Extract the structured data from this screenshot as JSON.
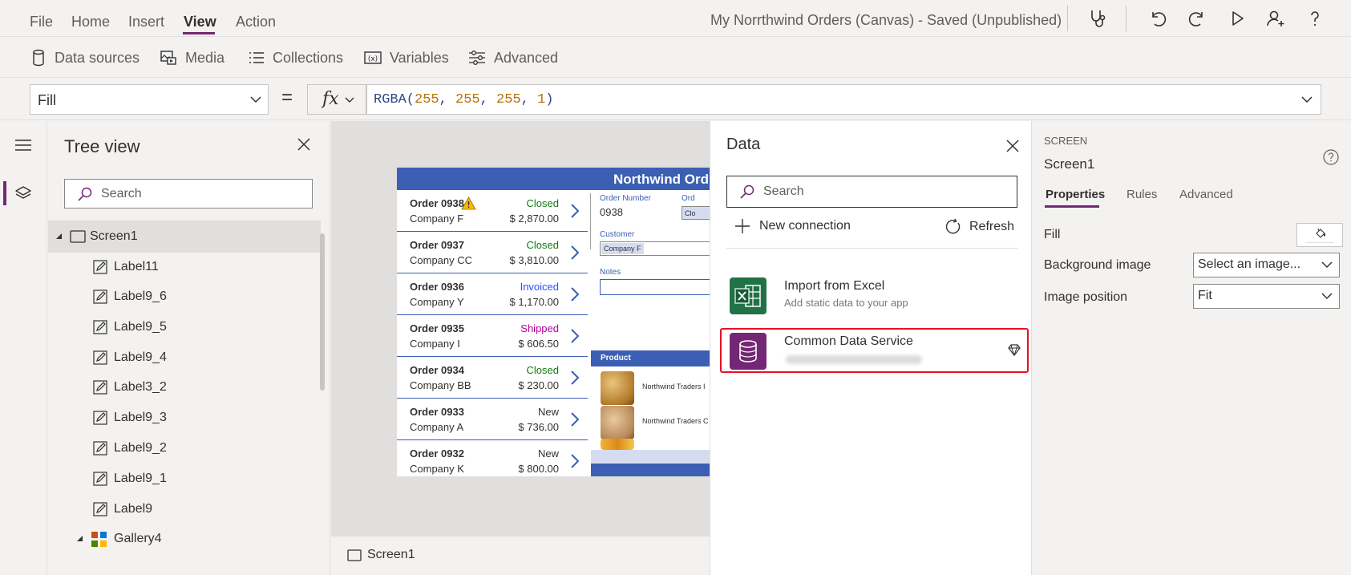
{
  "menu": {
    "items": [
      "File",
      "Home",
      "Insert",
      "View",
      "Action"
    ],
    "active": "View",
    "app_title": "My Norrthwind Orders (Canvas) - Saved (Unpublished)"
  },
  "toolbar_icons": [
    "stethoscope-icon",
    "undo-icon",
    "redo-icon",
    "play-icon",
    "add-user-icon",
    "help-icon"
  ],
  "ribbon": {
    "data_sources": "Data sources",
    "media": "Media",
    "collections": "Collections",
    "variables": "Variables",
    "advanced": "Advanced"
  },
  "formula": {
    "property": "Fill",
    "equals": "=",
    "fx": "fx",
    "fn": "RGBA(",
    "args": [
      "255",
      "255",
      "255",
      "1"
    ],
    "close": ")"
  },
  "tree": {
    "title": "Tree view",
    "search_placeholder": "Search",
    "items": [
      {
        "label": "Screen1",
        "type": "screen"
      },
      {
        "label": "Label11",
        "type": "label"
      },
      {
        "label": "Label9_6",
        "type": "label"
      },
      {
        "label": "Label9_5",
        "type": "label"
      },
      {
        "label": "Label9_4",
        "type": "label"
      },
      {
        "label": "Label3_2",
        "type": "label"
      },
      {
        "label": "Label9_3",
        "type": "label"
      },
      {
        "label": "Label9_2",
        "type": "label"
      },
      {
        "label": "Label9_1",
        "type": "label"
      },
      {
        "label": "Label9",
        "type": "label"
      },
      {
        "label": "Gallery4",
        "type": "gallery"
      }
    ]
  },
  "canvas": {
    "header": "Northwind Ord",
    "orders": [
      {
        "number": "Order 0938",
        "company": "Company F",
        "status": "Closed",
        "amount": "$ 2,870.00",
        "status_color": "#107c10",
        "warning": true
      },
      {
        "number": "Order 0937",
        "company": "Company CC",
        "status": "Closed",
        "amount": "$ 3,810.00",
        "status_color": "#107c10"
      },
      {
        "number": "Order 0936",
        "company": "Company Y",
        "status": "Invoiced",
        "amount": "$ 1,170.00",
        "status_color": "#2b4fff"
      },
      {
        "number": "Order 0935",
        "company": "Company I",
        "status": "Shipped",
        "amount": "$ 606.50",
        "status_color": "#b4009e"
      },
      {
        "number": "Order 0934",
        "company": "Company BB",
        "status": "Closed",
        "amount": "$ 230.00",
        "status_color": "#107c10"
      },
      {
        "number": "Order 0933",
        "company": "Company A",
        "status": "New",
        "amount": "$ 736.00",
        "status_color": "#323130"
      },
      {
        "number": "Order 0932",
        "company": "Company K",
        "status": "New",
        "amount": "$ 800.00",
        "status_color": "#323130"
      }
    ],
    "detail": {
      "order_number_label": "Order Number",
      "order_number": "0938",
      "order_status_label": "Ord",
      "status_chip": "Clo",
      "customer_label": "Customer",
      "customer": "Company F",
      "notes_label": "Notes",
      "product_header": "Product",
      "products": [
        "Northwind Traders I",
        "Northwind Traders C"
      ]
    },
    "screen_tab": "Screen1"
  },
  "data_pane": {
    "title": "Data",
    "search_placeholder": "Search",
    "new_connection": "New connection",
    "refresh": "Refresh",
    "connectors": [
      {
        "title": "Import from Excel",
        "subtitle": "Add static data to your app"
      },
      {
        "title": "Common Data Service",
        "subtitle": ""
      }
    ]
  },
  "properties": {
    "kind": "SCREEN",
    "name": "Screen1",
    "tabs": [
      "Properties",
      "Rules",
      "Advanced"
    ],
    "active_tab": "Properties",
    "fill_label": "Fill",
    "background_image_label": "Background image",
    "background_image_value": "Select an image...",
    "image_position_label": "Image position",
    "image_position_value": "Fit"
  },
  "colors": {
    "accent": "#742774",
    "northwind_blue": "#3b5fb3",
    "excel_green": "#217346",
    "cds_purple": "#742774",
    "highlight_red": "#e81123"
  }
}
